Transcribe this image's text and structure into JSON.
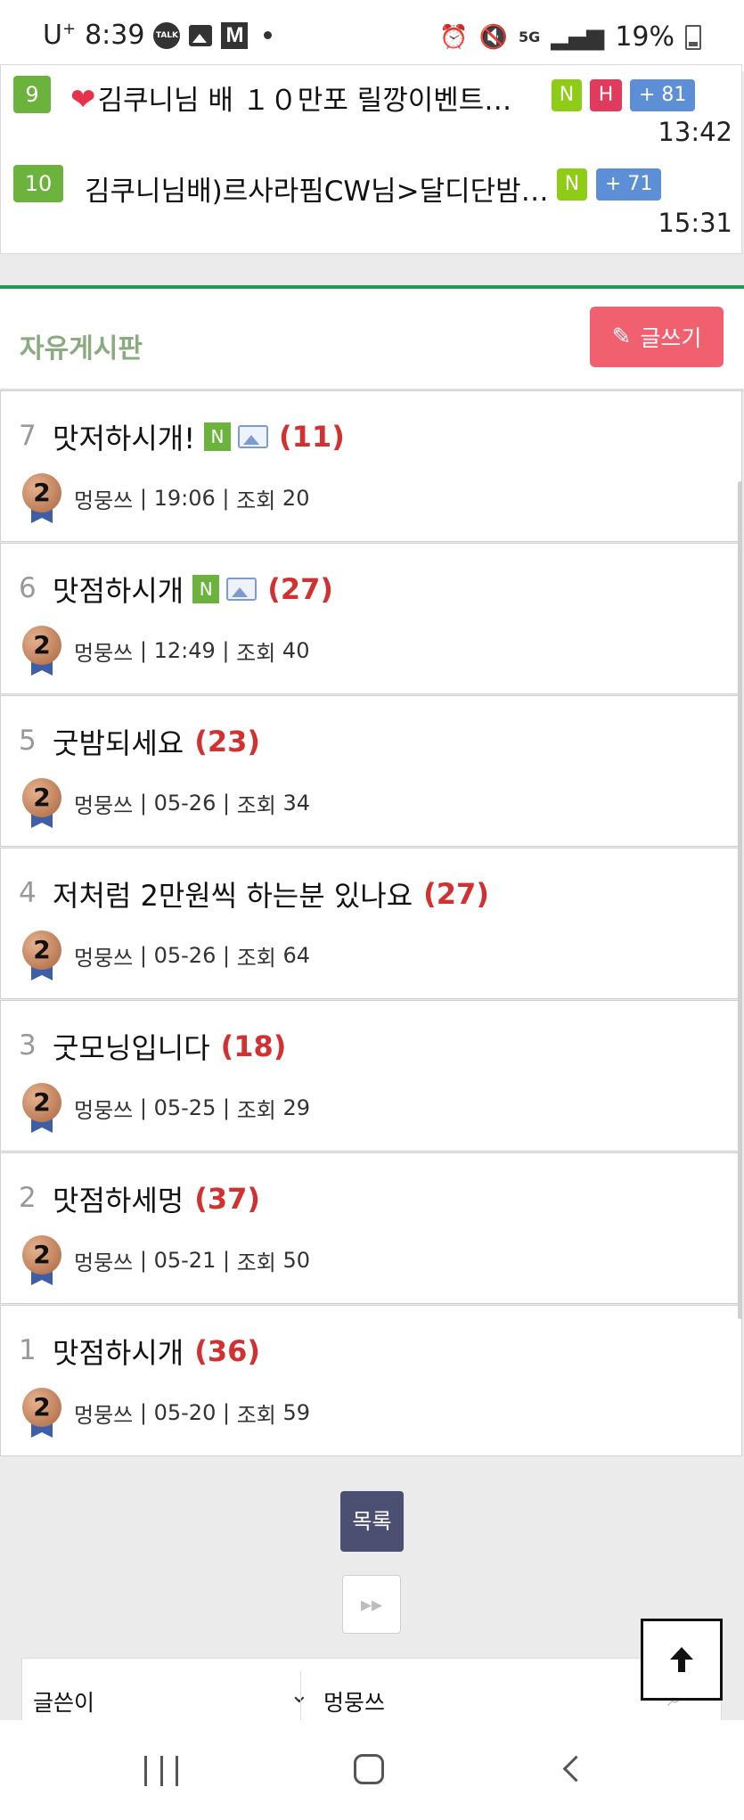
{
  "status_bar": {
    "carrier": "U",
    "carrier_sup": "+",
    "time": "8:39",
    "battery": "19%",
    "network": "5G"
  },
  "top_list": [
    {
      "rank": "9",
      "title": "김쿠니님 배 １０만포 릴깡이벤트…",
      "heart": true,
      "badges": [
        "N",
        "H"
      ],
      "count": "+ 81",
      "time": "13:42"
    },
    {
      "rank": "10",
      "title": "김쿠니님배)르사라핌CW님>달디단밤…",
      "heart": false,
      "badges": [
        "N"
      ],
      "count": "+ 71",
      "time": "15:31"
    }
  ],
  "board": {
    "title": "자유게시판",
    "write_label": "글쓰기"
  },
  "posts": [
    {
      "num": "7",
      "title": "맛저하시개!",
      "new": true,
      "image": true,
      "comments": "(11)",
      "author": "멍뭉쓰",
      "date": "19:06",
      "views_label": "조회",
      "views": "20"
    },
    {
      "num": "6",
      "title": "맛점하시개",
      "new": true,
      "image": true,
      "comments": "(27)",
      "author": "멍뭉쓰",
      "date": "12:49",
      "views_label": "조회",
      "views": "40"
    },
    {
      "num": "5",
      "title": "굿밤되세요",
      "new": false,
      "image": false,
      "comments": "(23)",
      "author": "멍뭉쓰",
      "date": "05-26",
      "views_label": "조회",
      "views": "34"
    },
    {
      "num": "4",
      "title": "저처럼 2만원씩 하는분 있나요",
      "new": false,
      "image": false,
      "comments": "(27)",
      "author": "멍뭉쓰",
      "date": "05-26",
      "views_label": "조회",
      "views": "64"
    },
    {
      "num": "3",
      "title": "굿모닝입니다",
      "new": false,
      "image": false,
      "comments": "(18)",
      "author": "멍뭉쓰",
      "date": "05-25",
      "views_label": "조회",
      "views": "29"
    },
    {
      "num": "2",
      "title": "맛점하세멍",
      "new": false,
      "image": false,
      "comments": "(37)",
      "author": "멍뭉쓰",
      "date": "05-21",
      "views_label": "조회",
      "views": "50"
    },
    {
      "num": "1",
      "title": "맛점하시개",
      "new": false,
      "image": false,
      "comments": "(36)",
      "author": "멍뭉쓰",
      "date": "05-20",
      "views_label": "조회",
      "views": "59"
    }
  ],
  "medal_level": "2",
  "new_badge": "N",
  "pagination": {
    "list_label": "목록",
    "next_label": "▸▸"
  },
  "search": {
    "field_label": "글쓴이",
    "value": "멍뭉쓰"
  },
  "colors": {
    "accent_green": "#1f9a57",
    "write_button": "#f0606f",
    "comment_red": "#d23131",
    "list_button": "#4b4f72"
  }
}
